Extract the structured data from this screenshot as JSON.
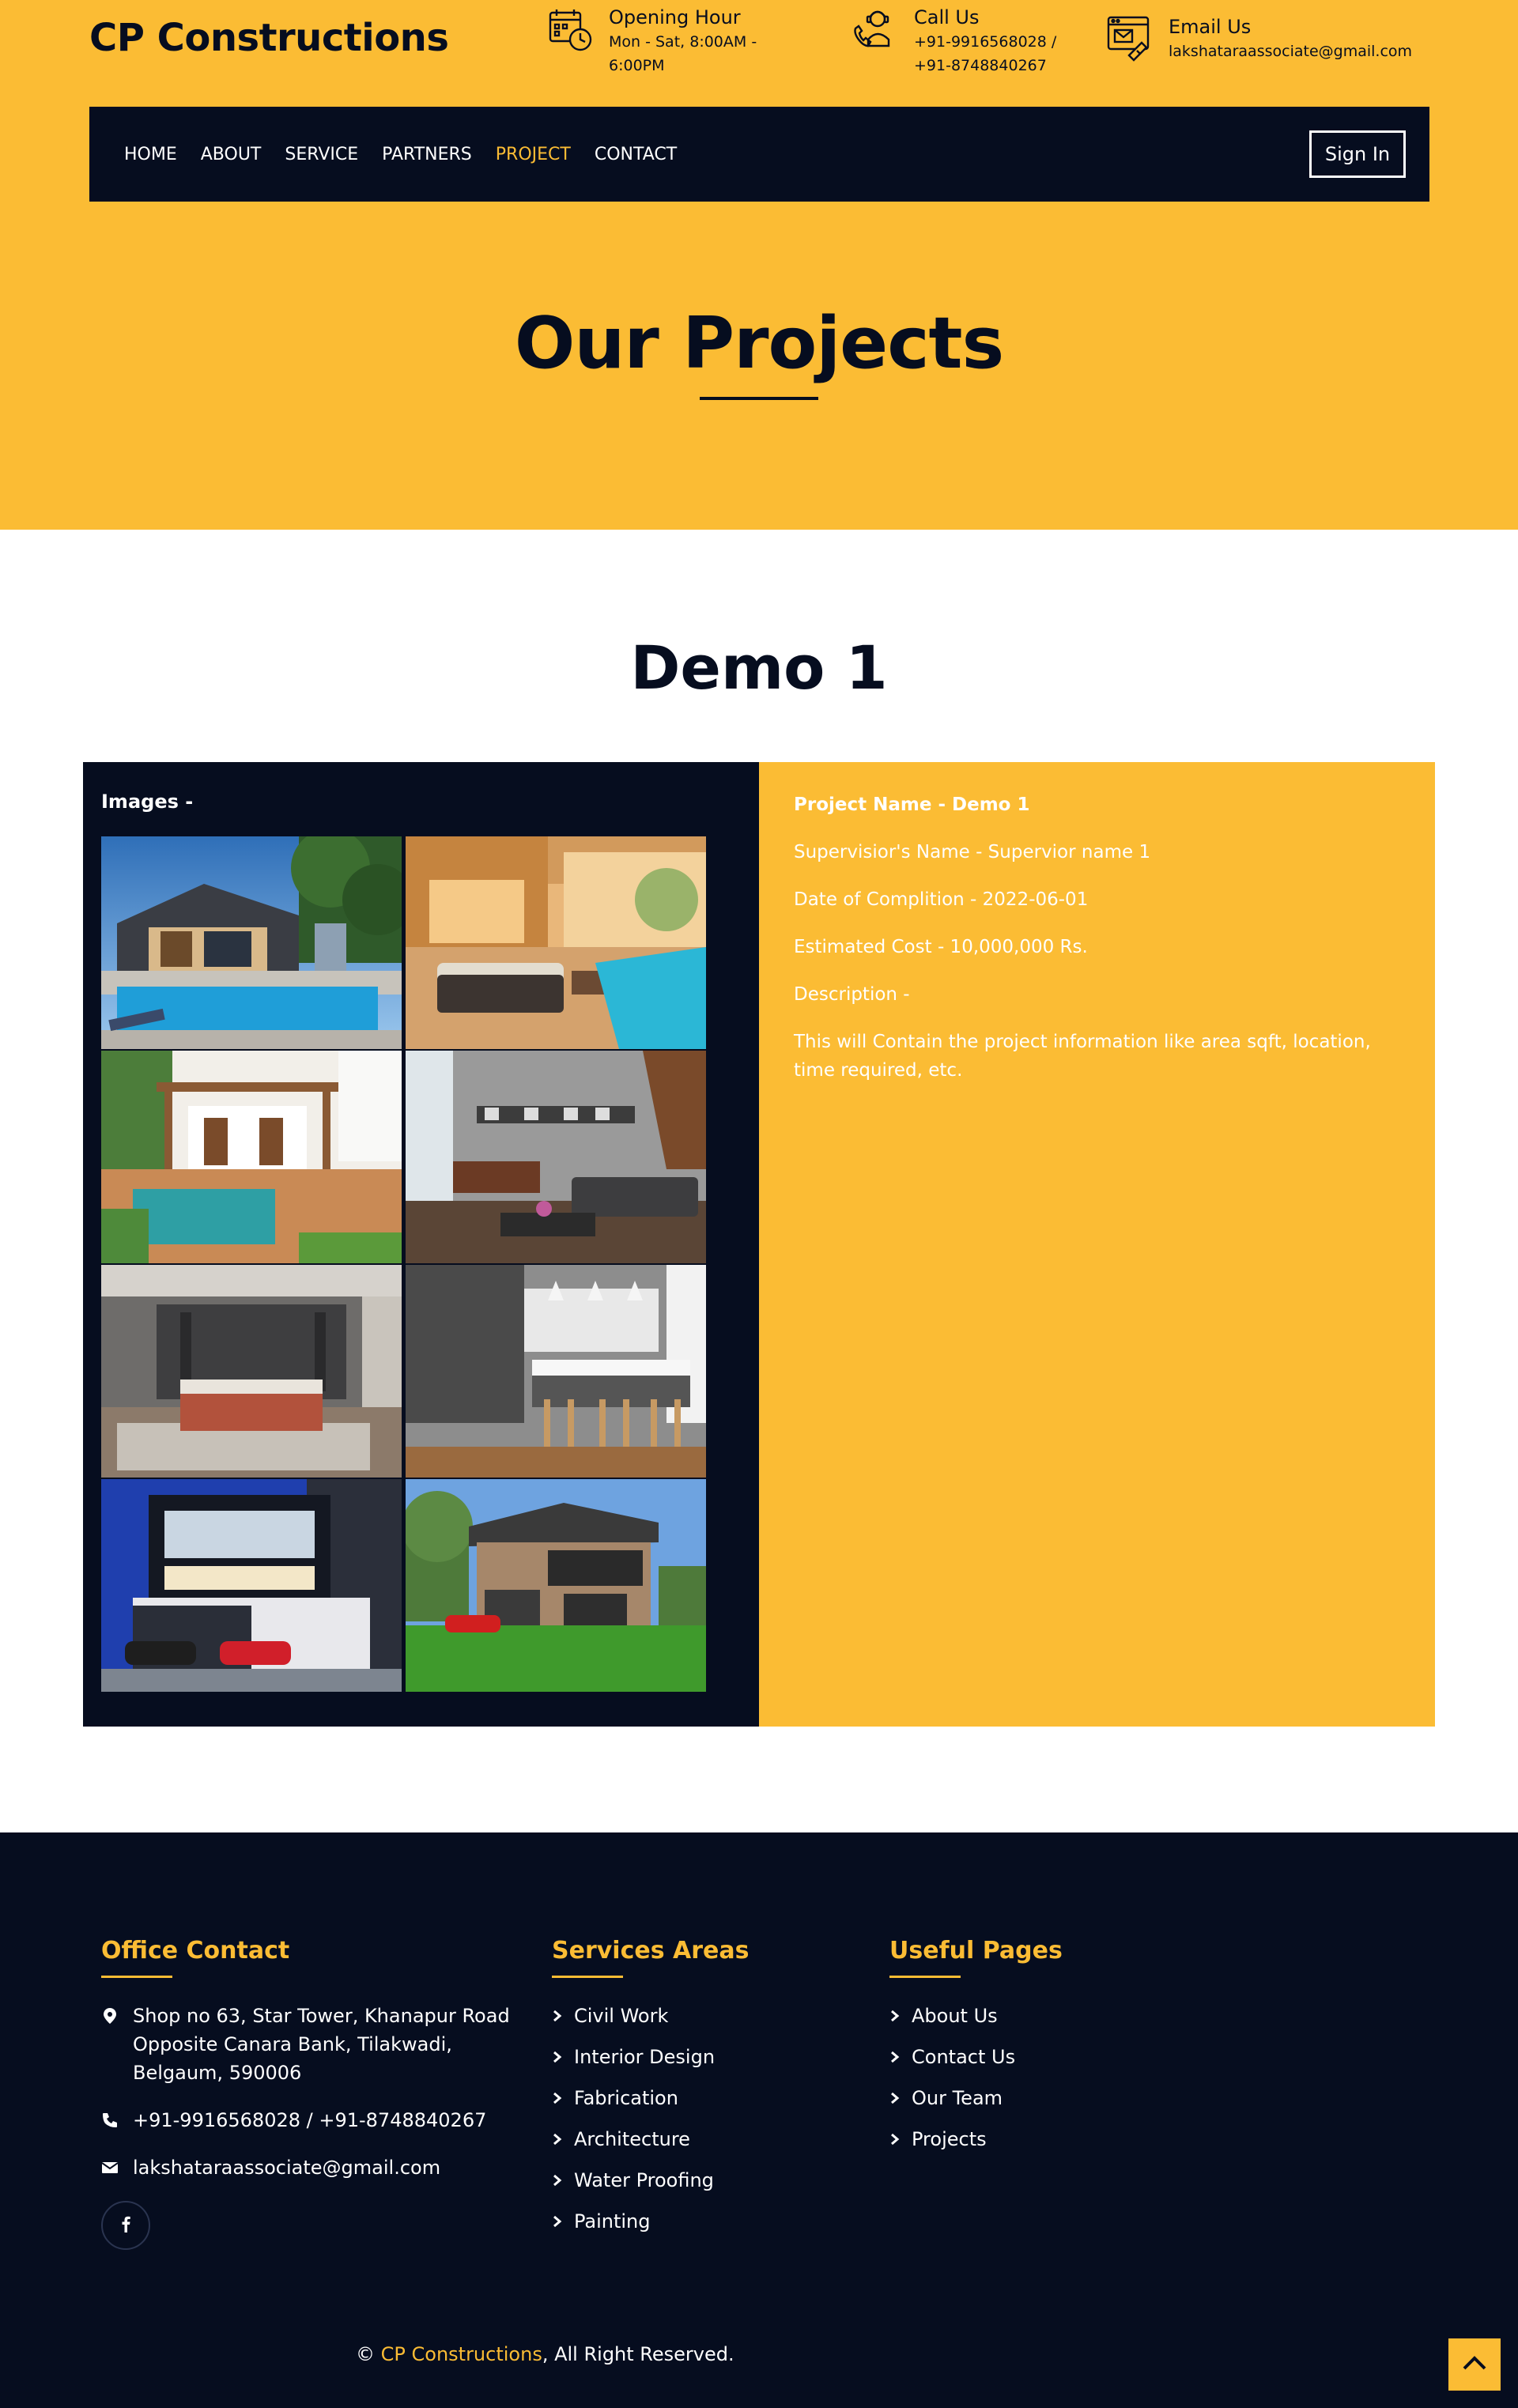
{
  "brand": {
    "name": "CP Constructions"
  },
  "topbar": {
    "hours": {
      "title": "Opening Hour",
      "value": "Mon - Sat, 8:00AM - 6:00PM",
      "icon": "calendar-clock-icon"
    },
    "call": {
      "title": "Call Us",
      "value": "+91-9916568028 / +91-8748840267",
      "icon": "phone-operator-icon"
    },
    "email": {
      "title": "Email Us",
      "value": "lakshataraassociate@gmail.com",
      "icon": "email-icon"
    }
  },
  "nav": {
    "items": [
      {
        "label": "HOME",
        "active": false
      },
      {
        "label": "ABOUT",
        "active": false
      },
      {
        "label": "SERVICE",
        "active": false
      },
      {
        "label": "PARTNERS",
        "active": false
      },
      {
        "label": "PROJECT",
        "active": true
      },
      {
        "label": "CONTACT",
        "active": false
      }
    ],
    "signin_label": "Sign In"
  },
  "hero": {
    "title": "Our Projects"
  },
  "project": {
    "title": "Demo 1",
    "images_label": "Images -",
    "images": [
      {
        "name": "pool-house-photo"
      },
      {
        "name": "patio-pool-lounge-photo"
      },
      {
        "name": "pergola-courtyard-pool-photo"
      },
      {
        "name": "grey-living-room-photo"
      },
      {
        "name": "bedroom-photo"
      },
      {
        "name": "kitchen-island-photo"
      },
      {
        "name": "modern-house-night-photo"
      },
      {
        "name": "stone-house-lawn-photo"
      }
    ],
    "details": {
      "name": "Project Name - Demo 1",
      "supervisor": "Supervisior's Name - Supervior name 1",
      "date": "Date of Complition - 2022-06-01",
      "cost": "Estimated Cost - 10,000,000 Rs.",
      "description_label": "Description -",
      "description": "This will Contain the project information like area sqft, location, time required, etc."
    }
  },
  "footer": {
    "office": {
      "title": "Office Contact",
      "address": "Shop no 63, Star Tower, Khanapur Road Opposite Canara Bank, Tilakwadi, Belgaum, 590006",
      "phone": "+91-9916568028 / +91-8748840267",
      "email": "lakshataraassociate@gmail.com",
      "social": "facebook-icon"
    },
    "services": {
      "title": "Services Areas",
      "items": [
        "Civil Work",
        "Interior Design",
        "Fabrication",
        "Architecture",
        "Water Proofing",
        "Painting"
      ]
    },
    "pages": {
      "title": "Useful Pages",
      "items": [
        "About Us",
        "Contact Us",
        "Our Team",
        "Projects"
      ]
    },
    "copyright": {
      "prefix": "©",
      "brand": "CP Constructions",
      "suffix": ", All Right Reserved."
    }
  },
  "colors": {
    "accent": "#fbbc34",
    "dark": "#060d1f",
    "white": "#ffffff"
  }
}
